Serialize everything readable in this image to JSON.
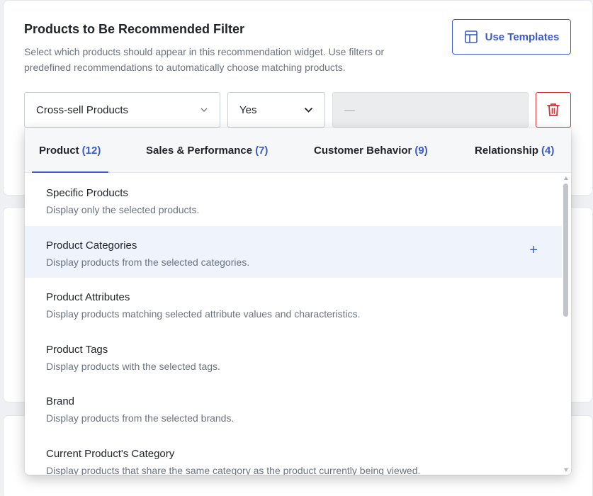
{
  "section": {
    "title": "Products to Be Recommended Filter",
    "description": "Select which products should appear in this recommendation widget. Use filters or predefined recommendations to automatically choose matching products.",
    "use_templates_label": "Use Templates"
  },
  "filter_row": {
    "type_value": "Cross-sell Products",
    "condition_value": "Yes",
    "value_placeholder": "—"
  },
  "dropdown": {
    "tabs": [
      {
        "label": "Product",
        "count": "(12)"
      },
      {
        "label": "Sales & Performance",
        "count": "(7)"
      },
      {
        "label": "Customer Behavior",
        "count": "(9)"
      },
      {
        "label": "Relationship",
        "count": "(4)"
      }
    ],
    "items": [
      {
        "name": "Specific Products",
        "desc": "Display only the selected products."
      },
      {
        "name": "Product Categories",
        "desc": "Display products from the selected categories."
      },
      {
        "name": "Product Attributes",
        "desc": "Display products matching selected attribute values and characteristics."
      },
      {
        "name": "Product Tags",
        "desc": "Display products with the selected tags."
      },
      {
        "name": "Brand",
        "desc": "Display products from the selected brands."
      },
      {
        "name": "Current Product's Category",
        "desc": "Display products that share the same category as the product currently being viewed."
      }
    ],
    "hover_plus": "+"
  },
  "colors": {
    "accent": "#3b5bcc",
    "danger": "#d13438",
    "hover_bg": "#eef3fc"
  }
}
